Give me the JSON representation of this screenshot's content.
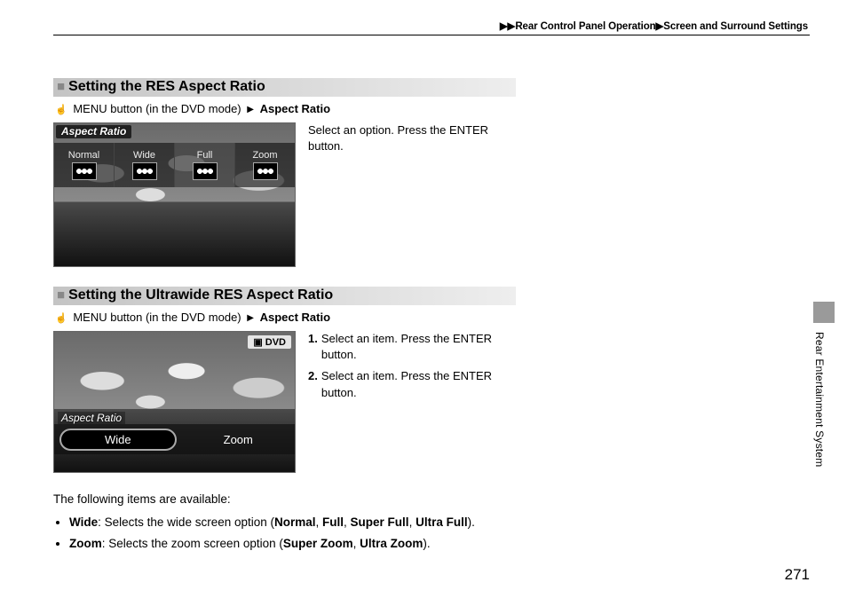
{
  "breadcrumb": {
    "arrows": "▶▶",
    "part1": "Rear Control Panel Operation",
    "sep": "▶",
    "part2": "Screen and Surround Settings"
  },
  "section1": {
    "title": "Setting the RES Aspect Ratio",
    "nav_pre": "MENU button (in the DVD mode)",
    "nav_target": "Aspect Ratio",
    "instr": "Select an option. Press the ENTER button.",
    "ar_label": "Aspect Ratio",
    "opts": [
      "Normal",
      "Wide",
      "Full",
      "Zoom"
    ]
  },
  "section2": {
    "title": "Setting the Ultrawide RES Aspect Ratio",
    "nav_pre": "MENU button (in the DVD mode)",
    "nav_target": "Aspect Ratio",
    "step1": "Select an item. Press the ENTER button.",
    "step2": "Select an item. Press the ENTER button.",
    "ar_label": "Aspect Ratio",
    "dvd_badge": "DVD",
    "opts": [
      "Wide",
      "Zoom"
    ]
  },
  "following_intro": "The following items are available:",
  "bullets": {
    "wide": {
      "name": "Wide",
      "desc_pre": ": Selects the wide screen option (",
      "o1": "Normal",
      "o2": "Full",
      "o3": "Super Full",
      "o4": "Ultra Full",
      "desc_post": ")."
    },
    "zoom": {
      "name": "Zoom",
      "desc_pre": ": Selects the zoom screen option (",
      "o1": "Super Zoom",
      "o2": "Ultra Zoom",
      "desc_post": ")."
    }
  },
  "side_tab": "Rear Entertainment System",
  "page_number": "271"
}
